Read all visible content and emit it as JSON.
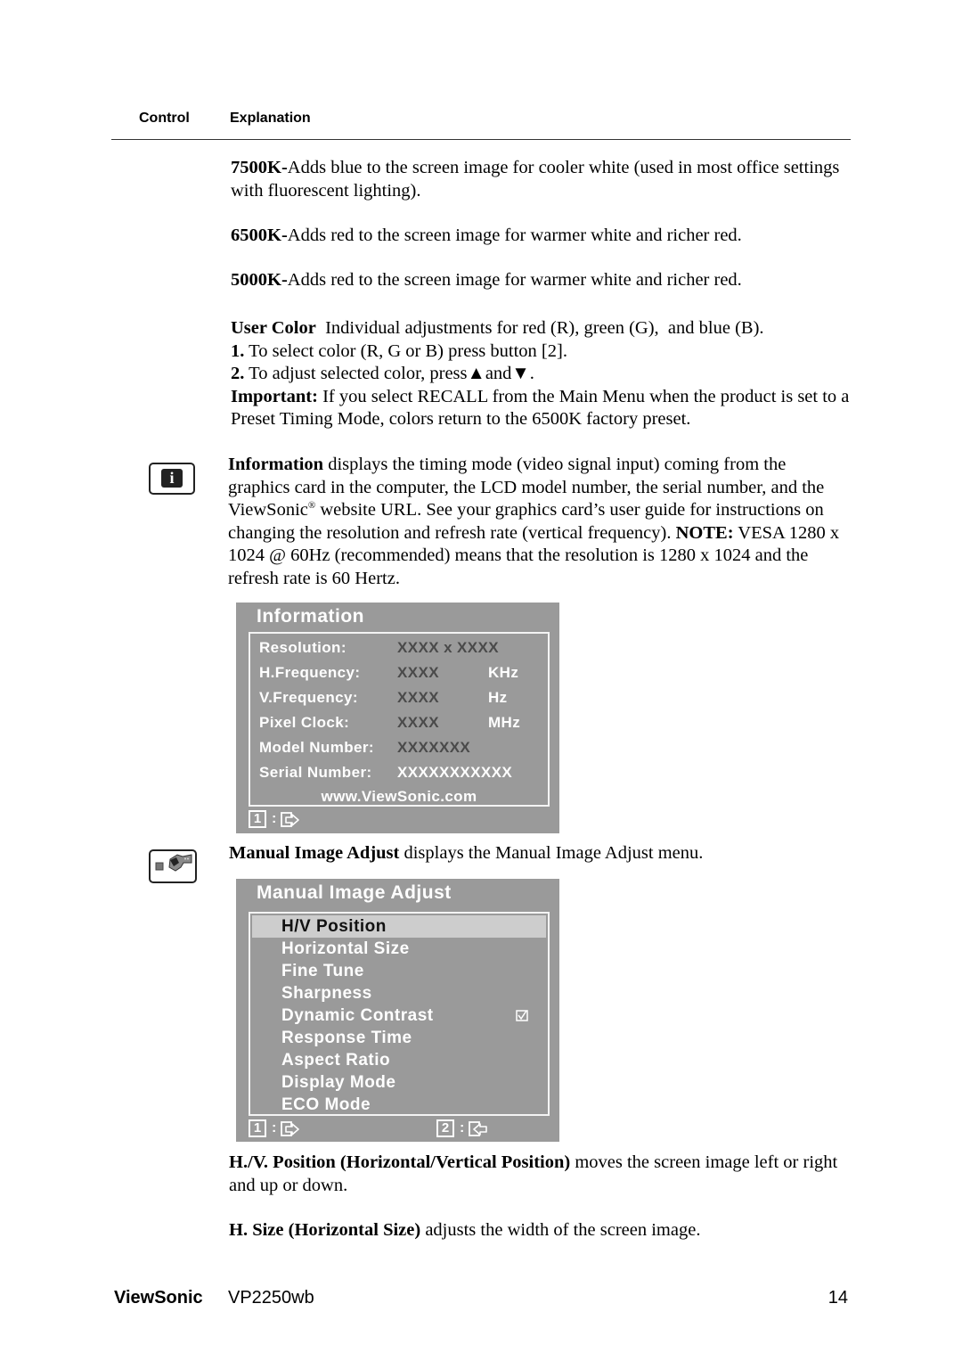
{
  "table_header": {
    "control": "Control",
    "explanation": "Explanation"
  },
  "color_temps": [
    {
      "term": "7500K-",
      "text": "Adds blue to the screen image for cooler white (used in most office settings with fluorescent lighting)."
    },
    {
      "term": "6500K-",
      "text": "Adds red to the screen image for warmer white and richer red."
    },
    {
      "term": "5000K-",
      "text": "Adds red to the screen image for warmer white and richer red."
    }
  ],
  "user_color": {
    "term": "User Color",
    "text": "  Individual adjustments for red (R), green (G),  and blue (B).",
    "step1_num": "1.",
    "step1_text": " To select color (R, G or B) press button [2].",
    "step2_num": "2.",
    "step2_text_a": " To adjust selected color, press",
    "up_glyph": "▲",
    "and": "and",
    "down_glyph": "▼",
    "step2_end": ".",
    "important_term": "Important:",
    "important_text": " If you select RECALL from the Main Menu when the product is set to a Preset Timing Mode, colors return to the 6500K factory preset."
  },
  "information": {
    "icon": "information-icon",
    "glyph": "i",
    "term": "Information",
    "text_a": " displays the timing mode (video signal input) coming from the graphics card in the computer, the LCD model number, the serial number, and the ViewSonic",
    "reg": "®",
    "text_b": " website URL. See your graphics card’s user guide for instructions on changing the resolution and refresh rate (vertical frequency).",
    "note_term": "NOTE:",
    "note_text": " VESA 1280 x 1024 @ 60Hz (recommended) means that the resolution is 1280 x 1024 and the refresh rate is 60 Hertz."
  },
  "info_osd": {
    "title": "Information",
    "rows": [
      {
        "label": "Resolution:",
        "value": "XXXX x XXXX",
        "unit": ""
      },
      {
        "label": "H.Frequency:",
        "value": "XXXX",
        "unit": "KHz"
      },
      {
        "label": "V.Frequency:",
        "value": "XXXX",
        "unit": "Hz"
      },
      {
        "label": "Pixel Clock:",
        "value": "XXXX",
        "unit": "MHz"
      },
      {
        "label": "Model Number:",
        "value": "XXXXXXX",
        "unit": ""
      },
      {
        "label": "Serial Number:",
        "value": "XXXXXXXXXXX",
        "unit": ""
      }
    ],
    "url": "www.ViewSonic.com",
    "footer_key": "1",
    "footer_colon": ":",
    "footer_icon": "exit-icon"
  },
  "manual_image_adjust": {
    "icon": "wrench-icon",
    "term": "Manual Image Adjust",
    "text": " displays the Manual Image Adjust menu."
  },
  "mia_osd": {
    "title": "Manual Image Adjust",
    "items": [
      {
        "label": "H/V Position",
        "selected": true,
        "checked": false
      },
      {
        "label": "Horizontal Size",
        "selected": false,
        "checked": false
      },
      {
        "label": "Fine Tune",
        "selected": false,
        "checked": false
      },
      {
        "label": "Sharpness",
        "selected": false,
        "checked": false
      },
      {
        "label": "Dynamic Contrast",
        "selected": false,
        "checked": true
      },
      {
        "label": "Response Time",
        "selected": false,
        "checked": false
      },
      {
        "label": "Aspect Ratio",
        "selected": false,
        "checked": false
      },
      {
        "label": "Display Mode",
        "selected": false,
        "checked": false
      },
      {
        "label": "ECO Mode",
        "selected": false,
        "checked": false
      }
    ],
    "footer": [
      {
        "key": "1",
        "colon": ":",
        "icon": "exit-icon"
      },
      {
        "key": "2",
        "colon": ":",
        "icon": "enter-icon"
      }
    ]
  },
  "hv_position": {
    "term": "H./V. Position (Horizontal/Vertical Position)",
    "text": " moves the screen image left or right and up or down."
  },
  "h_size": {
    "term": "H. Size (Horizontal Size)",
    "text": " adjusts the width of the screen image."
  },
  "footer": {
    "brand": "ViewSonic",
    "model": "VP2250wb",
    "page": "14"
  }
}
